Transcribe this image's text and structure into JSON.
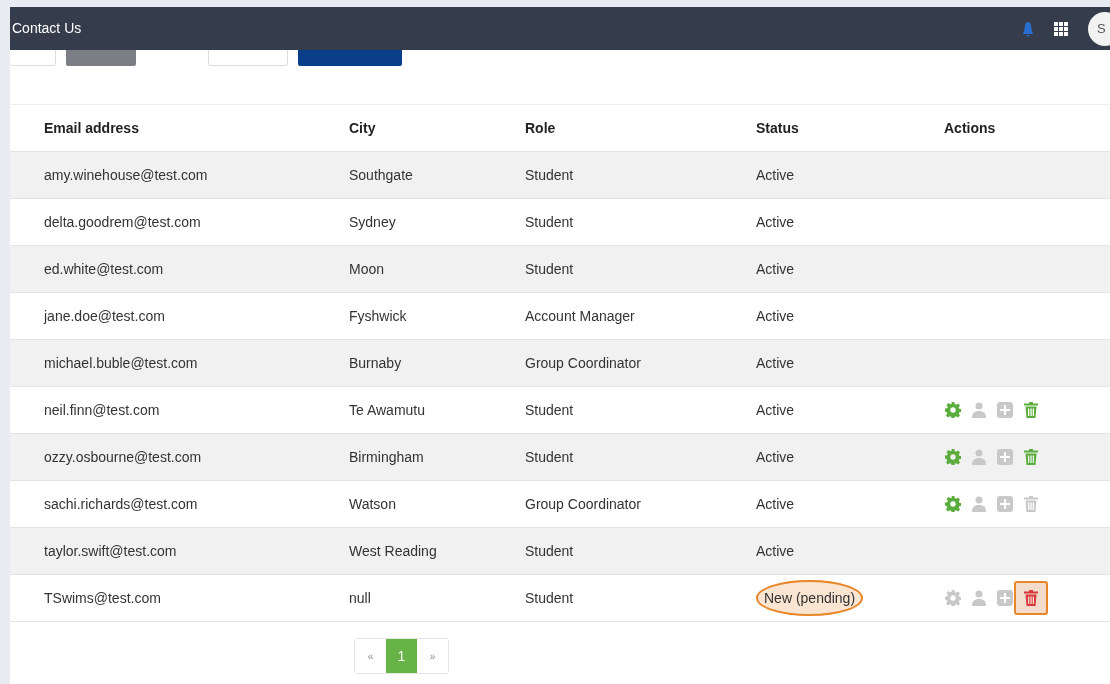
{
  "navbar": {
    "title": "Contact Us",
    "avatar": "S"
  },
  "table": {
    "columns": [
      "Email address",
      "City",
      "Role",
      "Status",
      "Actions"
    ],
    "rows": [
      {
        "email": "amy.winehouse@test.com",
        "city": "Southgate",
        "role": "Student",
        "status": "Active",
        "actions": []
      },
      {
        "email": "delta.goodrem@test.com",
        "city": "Sydney",
        "role": "Student",
        "status": "Active",
        "actions": []
      },
      {
        "email": "ed.white@test.com",
        "city": "Moon",
        "role": "Student",
        "status": "Active",
        "actions": []
      },
      {
        "email": "jane.doe@test.com",
        "city": "Fyshwick",
        "role": "Account Manager",
        "status": "Active",
        "actions": []
      },
      {
        "email": "michael.buble@test.com",
        "city": "Burnaby",
        "role": "Group Coordinator",
        "status": "Active",
        "actions": []
      },
      {
        "email": "neil.finn@test.com",
        "city": "Te Awamutu",
        "role": "Student",
        "status": "Active",
        "actions": [
          {
            "kind": "gear",
            "enabled": true,
            "danger": false
          },
          {
            "kind": "user",
            "enabled": false,
            "danger": false
          },
          {
            "kind": "plus",
            "enabled": false,
            "danger": false
          },
          {
            "kind": "trash",
            "enabled": true,
            "danger": false
          }
        ]
      },
      {
        "email": "ozzy.osbourne@test.com",
        "city": "Birmingham",
        "role": "Student",
        "status": "Active",
        "actions": [
          {
            "kind": "gear",
            "enabled": true,
            "danger": false
          },
          {
            "kind": "user",
            "enabled": false,
            "danger": false
          },
          {
            "kind": "plus",
            "enabled": false,
            "danger": false
          },
          {
            "kind": "trash",
            "enabled": true,
            "danger": false
          }
        ]
      },
      {
        "email": "sachi.richards@test.com",
        "city": "Watson",
        "role": "Group Coordinator",
        "status": "Active",
        "actions": [
          {
            "kind": "gear",
            "enabled": true,
            "danger": false
          },
          {
            "kind": "user",
            "enabled": false,
            "danger": false
          },
          {
            "kind": "plus",
            "enabled": false,
            "danger": false
          },
          {
            "kind": "trash",
            "enabled": false,
            "danger": false
          }
        ]
      },
      {
        "email": "taylor.swift@test.com",
        "city": "West Reading",
        "role": "Student",
        "status": "Active",
        "actions": []
      },
      {
        "email": "TSwims@test.com",
        "city": "null",
        "role": "Student",
        "status": "New (pending)",
        "status_highlighted": true,
        "actions": [
          {
            "kind": "gear",
            "enabled": false,
            "danger": false
          },
          {
            "kind": "user",
            "enabled": false,
            "danger": false
          },
          {
            "kind": "plus",
            "enabled": false,
            "danger": false
          },
          {
            "kind": "trash",
            "enabled": true,
            "danger": true,
            "highlighted": true
          }
        ]
      }
    ]
  },
  "pagination": [
    {
      "label": "«",
      "selected": false
    },
    {
      "label": "1",
      "selected": true
    },
    {
      "label": "»",
      "selected": false
    }
  ]
}
